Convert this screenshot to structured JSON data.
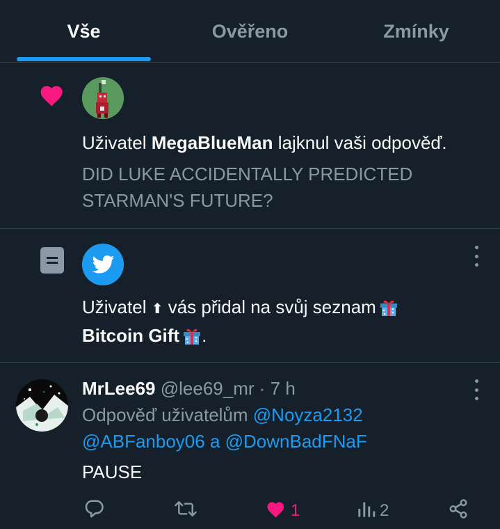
{
  "tabs": [
    {
      "label": "Vše",
      "active": true
    },
    {
      "label": "Ověřeno",
      "active": false
    },
    {
      "label": "Zmínky",
      "active": false
    }
  ],
  "notifications": [
    {
      "type_icon": "heart-icon",
      "text_prefix": "Uživatel ",
      "user": "MegaBlueMan",
      "text_suffix": " lajknul vaši odpověď.",
      "quote": "DID LUKE ACCIDENTALLY PREDICTED STARMAN'S FUTURE?"
    },
    {
      "type_icon": "list-icon",
      "text_prefix": "Uživatel ",
      "user_symbol": "⬆",
      "text_middle": " vás přidal na svůj seznam",
      "list_name": "Bitcoin Gift",
      "trailing": "."
    },
    {
      "name": "MrLee69",
      "handle": "@lee69_mr",
      "separator": " · ",
      "time": "7 h",
      "reply_prefix": "Odpověď uživatelům ",
      "mention1": "@Noyza2132",
      "mention2": "@ABFanboy06",
      "reply_and": " a ",
      "mention3": "@DownBadFNaF",
      "text": "PAUSE",
      "like_count": "1",
      "view_count": "2"
    }
  ],
  "colors": {
    "background": "#15202b",
    "accent": "#1d9bf0",
    "like": "#f91880",
    "muted": "#8b98a5",
    "divider": "#38444d"
  }
}
